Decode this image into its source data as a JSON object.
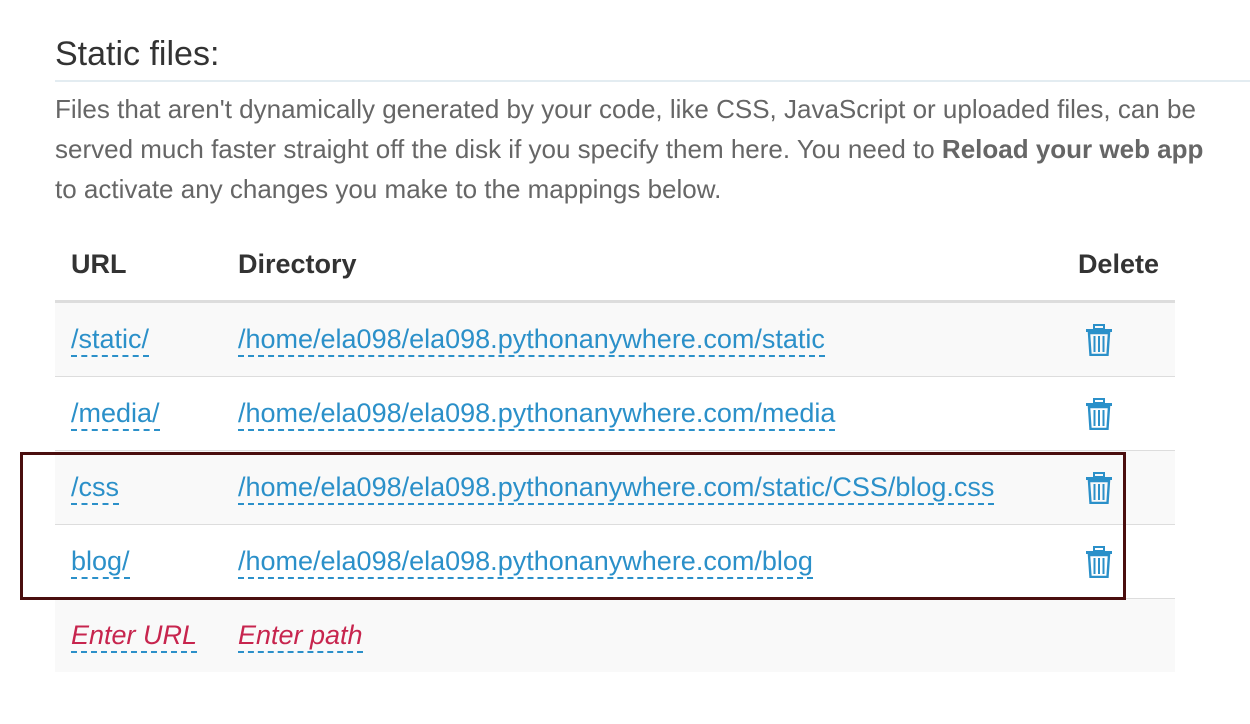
{
  "section": {
    "title": "Static files:",
    "intro_text_before": "Files that aren't dynamically generated by your code, like CSS, JavaScript or uploaded files, can be served much faster straight off the disk if you specify them here. You need to ",
    "intro_bold": "Reload your web app",
    "intro_text_after": " to activate any changes you make to the mappings below."
  },
  "table": {
    "headers": {
      "url": "URL",
      "directory": "Directory",
      "delete": "Delete"
    },
    "rows": [
      {
        "url": "/static/",
        "directory": "/home/ela098/ela098.pythonanywhere.com/static"
      },
      {
        "url": "/media/",
        "directory": "/home/ela098/ela098.pythonanywhere.com/media"
      },
      {
        "url": "/css",
        "directory": "/home/ela098/ela098.pythonanywhere.com/static/CSS/blog.css"
      },
      {
        "url": "blog/",
        "directory": "/home/ela098/ela098.pythonanywhere.com/blog"
      }
    ],
    "new_entry": {
      "url_placeholder": "Enter URL",
      "path_placeholder": "Enter path"
    }
  },
  "icons": {
    "delete": "trash-icon"
  },
  "colors": {
    "link": "#2b90c9",
    "placeholder": "#c7254e",
    "highlight_border": "#4a0e0e"
  }
}
